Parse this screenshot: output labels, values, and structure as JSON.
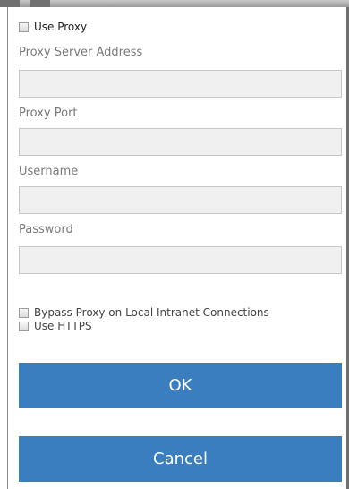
{
  "proxy": {
    "use_proxy_label": "Use Proxy",
    "server_label": "Proxy Server Address",
    "server_value": "",
    "port_label": "Proxy Port",
    "port_value": "",
    "username_label": "Username",
    "username_value": "",
    "password_label": "Password",
    "password_value": "",
    "bypass_label": "Bypass Proxy on Local Intranet Connections",
    "https_label": "Use HTTPS"
  },
  "buttons": {
    "ok_label": "OK",
    "cancel_label": "Cancel"
  },
  "colors": {
    "button_blue": "#3a7ebf",
    "input_bg": "#f0f0f0",
    "label_gray": "#7a7a7a"
  }
}
